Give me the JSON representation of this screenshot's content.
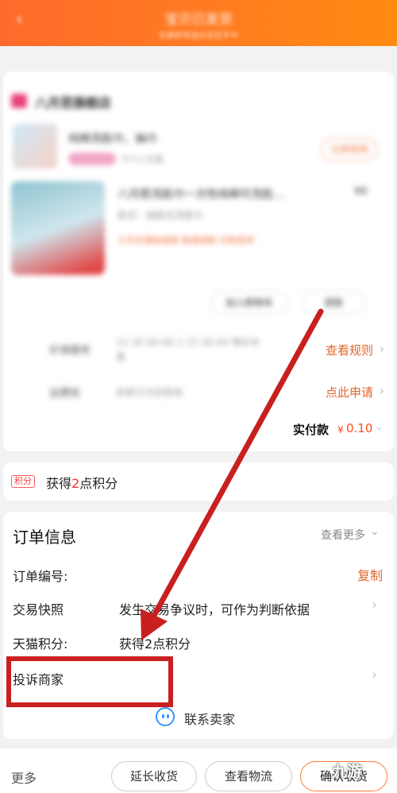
{
  "header": {
    "title": "宝贝已发货",
    "subtitle": "包裹即将送达至您手中"
  },
  "store": {
    "name": "八月苣旗舰店",
    "promo_title": "纯棉洗脸巾、抽巾",
    "promo_sub": "377人在看",
    "promo_button": "立即抢购",
    "product_title": "八月苣洗脸巾一次性纯棉可洗脸…",
    "product_price": "¥0",
    "product_spec": "款式：抽取式洗脸巾",
    "product_tags": "七天无理由退换   极速退款   闪电发货",
    "btn_add_cart": "加入购物车",
    "btn_refund": "退款",
    "row1_label": "价保服务",
    "row1_value": "12.30 00:00-1.15 00:00 降价补差",
    "row1_link": "查看规则",
    "row2_label": "运费险",
    "row2_value": "卖家已为您投保",
    "row2_link": "点此申请",
    "paid_label": "实付款",
    "paid_currency": "¥",
    "paid_amount": "0.10"
  },
  "points": {
    "badge": "积分",
    "text_pre": "获得",
    "text_num": "2",
    "text_post": "点积分"
  },
  "order": {
    "title": "订单信息",
    "see_more": "查看更多",
    "number_label": "订单编号:",
    "copy": "复制",
    "snapshot_label": "交易快照",
    "snapshot_value": "发生交易争议时，可作为判断依据",
    "tmall_points_label": "天猫积分:",
    "tmall_points_value": "获得2点积分",
    "complain_label": "投诉商家",
    "contact": "联系卖家"
  },
  "bottom": {
    "more": "更多",
    "extend": "延长收货",
    "logistics": "查看物流",
    "confirm": "确认收货",
    "watermark": "九游"
  },
  "colors": {
    "header_start": "#ff6a2b",
    "accent": "#e0652a",
    "price": "#ff4a1a",
    "annotation": "#c8201f"
  }
}
